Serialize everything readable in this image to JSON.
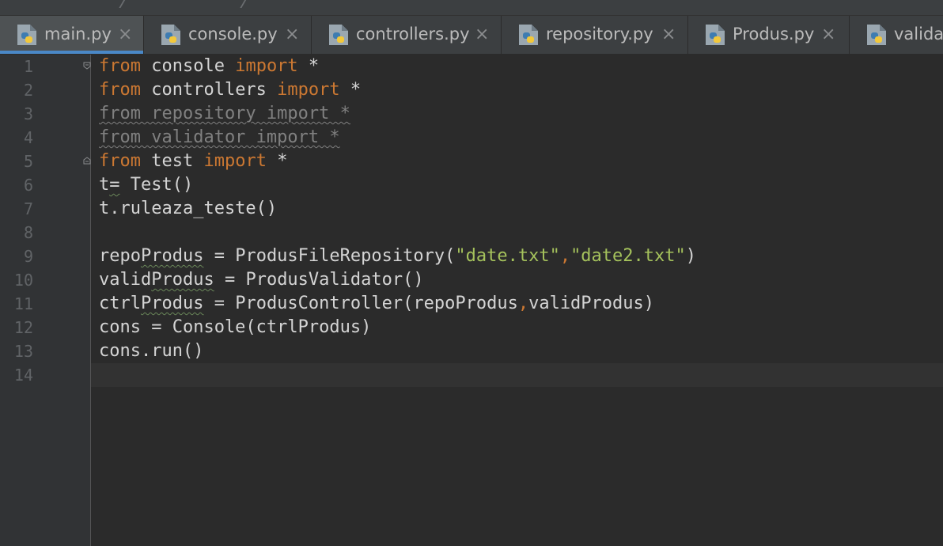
{
  "colors": {
    "background": "#2b2b2b",
    "tabbar": "#3c3f41",
    "active_tab": "#4e5254",
    "active_underline": "#4a88c7",
    "keyword": "#cc7832",
    "string": "#a5c25c",
    "text": "#d4d4d4",
    "line_number": "#606366"
  },
  "tabs": [
    {
      "label": "main.py",
      "icon": "python-file-icon",
      "close": "×"
    },
    {
      "label": "console.py",
      "icon": "python-file-icon",
      "close": "×"
    },
    {
      "label": "controllers.py",
      "icon": "python-file-icon",
      "close": "×"
    },
    {
      "label": "repository.py",
      "icon": "python-file-icon",
      "close": "×"
    },
    {
      "label": "Produs.py",
      "icon": "python-file-icon",
      "close": "×"
    },
    {
      "label": "validat",
      "icon": "python-file-icon"
    }
  ],
  "line_numbers": [
    "1",
    "2",
    "3",
    "4",
    "5",
    "6",
    "7",
    "8",
    "9",
    "10",
    "11",
    "12",
    "13",
    "14"
  ],
  "code": {
    "l1": {
      "kw1": "from",
      "mod": " console ",
      "kw2": "import",
      "rest": " *"
    },
    "l2": {
      "kw1": "from",
      "mod": " controllers ",
      "kw2": "import",
      "rest": " *"
    },
    "l3": "from repository import *",
    "l4": "from validator import *",
    "l5": {
      "kw1": "from",
      "mod": " test ",
      "kw2": "import",
      "rest": " *"
    },
    "l6": {
      "a": "t",
      "b": "=",
      "c": " Test()"
    },
    "l7": "t.ruleaza_teste()",
    "l9": {
      "a": "repo",
      "b": "Produs",
      "c": " = ProdusFileRepository(",
      "s1": "\"date.txt\"",
      "comma": ",",
      "s2": "\"date2.txt\"",
      "d": ")"
    },
    "l10": {
      "a": "valid",
      "b": "Produs",
      "c": " = ProdusValidator()"
    },
    "l11": {
      "a": "ctrl",
      "b": "Produs",
      "c": " = ProdusController(repoProdus",
      "comma": ",",
      "d": "validProdus)"
    },
    "l12": "cons = Console(ctrlProdus)",
    "l13": "cons.run()"
  }
}
